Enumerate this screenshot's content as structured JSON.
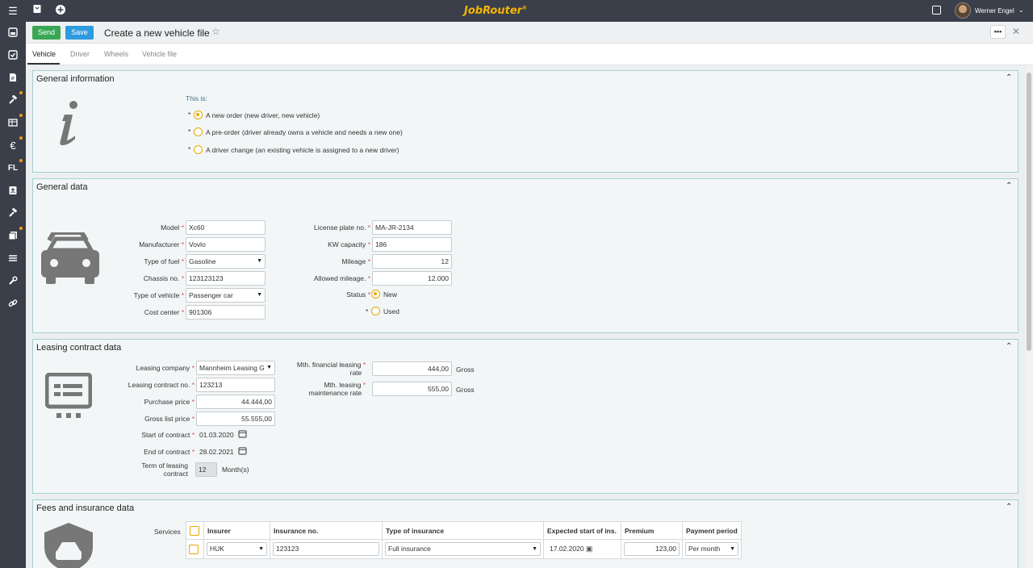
{
  "topbar": {
    "logo": "JobRouter",
    "trademark": "®",
    "user_name": "Werner Engel"
  },
  "colors": {
    "send": "#3aa655",
    "save": "#2e9be0",
    "accent": "#f5b400",
    "sidebar": "#3a3f4a",
    "required": "#d9534f",
    "radio": "#e6a800"
  },
  "header": {
    "send_label": "Send",
    "save_label": "Save",
    "title": "Create a new vehicle file",
    "more": "•••"
  },
  "tabs": [
    {
      "label": "Vehicle"
    },
    {
      "label": "Driver"
    },
    {
      "label": "Wheels"
    },
    {
      "label": "Vehicle file"
    }
  ],
  "general_info": {
    "title": "General information",
    "question": "This is:",
    "options": [
      {
        "label": "A new order (new driver, new vehicle)",
        "selected": true
      },
      {
        "label": "A pre-order (driver already owns a vehicle and needs a new one)",
        "selected": false
      },
      {
        "label": "A driver change (an existing vehicle is assigned to a new driver)",
        "selected": false
      }
    ]
  },
  "general_data": {
    "title": "General data",
    "left": [
      {
        "label": "Model",
        "value": "Xc60"
      },
      {
        "label": "Manufacturer",
        "value": "Vovlo"
      },
      {
        "label": "Type of fuel",
        "value": "Gasoline"
      },
      {
        "label": "Chassis no.",
        "value": "123123123"
      },
      {
        "label": "Type of vehicle",
        "value": "Passenger car"
      },
      {
        "label": "Cost center",
        "value": "901306"
      }
    ],
    "right": [
      {
        "label": "License plate no.",
        "value": "MA-JR-2134"
      },
      {
        "label": "KW capacity",
        "value": "186"
      },
      {
        "label": "Mileage",
        "value": "12"
      },
      {
        "label": "Allowed mileage.",
        "value": "12.000"
      }
    ],
    "status_label": "Status",
    "status_options": [
      {
        "label": "New",
        "selected": true
      },
      {
        "label": "Used",
        "selected": false
      }
    ]
  },
  "leasing": {
    "title": "Leasing contract data",
    "fields": [
      {
        "label": "Leasing company",
        "value": "Mannheim Leasing G"
      },
      {
        "label": "Leasing contract no.",
        "value": "123213"
      },
      {
        "label": "Purchase price",
        "value": "44.444,00"
      },
      {
        "label": "Gross list price",
        "value": "55.555,00"
      },
      {
        "label": "Start of contract",
        "value": "01.03.2020"
      },
      {
        "label": "End of contract",
        "value": "28.02.2021"
      }
    ],
    "term_label_1": "Term of leasing",
    "term_label_2": "contract",
    "term_value": "12",
    "term_unit": "Month(s)",
    "financial_label_1": "Mth. financial leasing",
    "financial_label_2": "rate",
    "financial_value": "444,00",
    "maintenance_label_1": "Mth. leasing",
    "maintenance_label_2": "maintenance rate",
    "maintenance_value": "555,00",
    "gross": "Gross"
  },
  "fees": {
    "title": "Fees and insurance data",
    "services_label": "Services",
    "columns": [
      "Insurer",
      "Insurance no.",
      "Type of insurance",
      "Expected start of ins.",
      "Premium",
      "Payment period"
    ],
    "rows": [
      {
        "insurer": "HUK",
        "insurance_no": "123123",
        "type": "Full insurance",
        "start": "17.02.2020",
        "premium": "123,00",
        "period": "Per month"
      }
    ]
  }
}
